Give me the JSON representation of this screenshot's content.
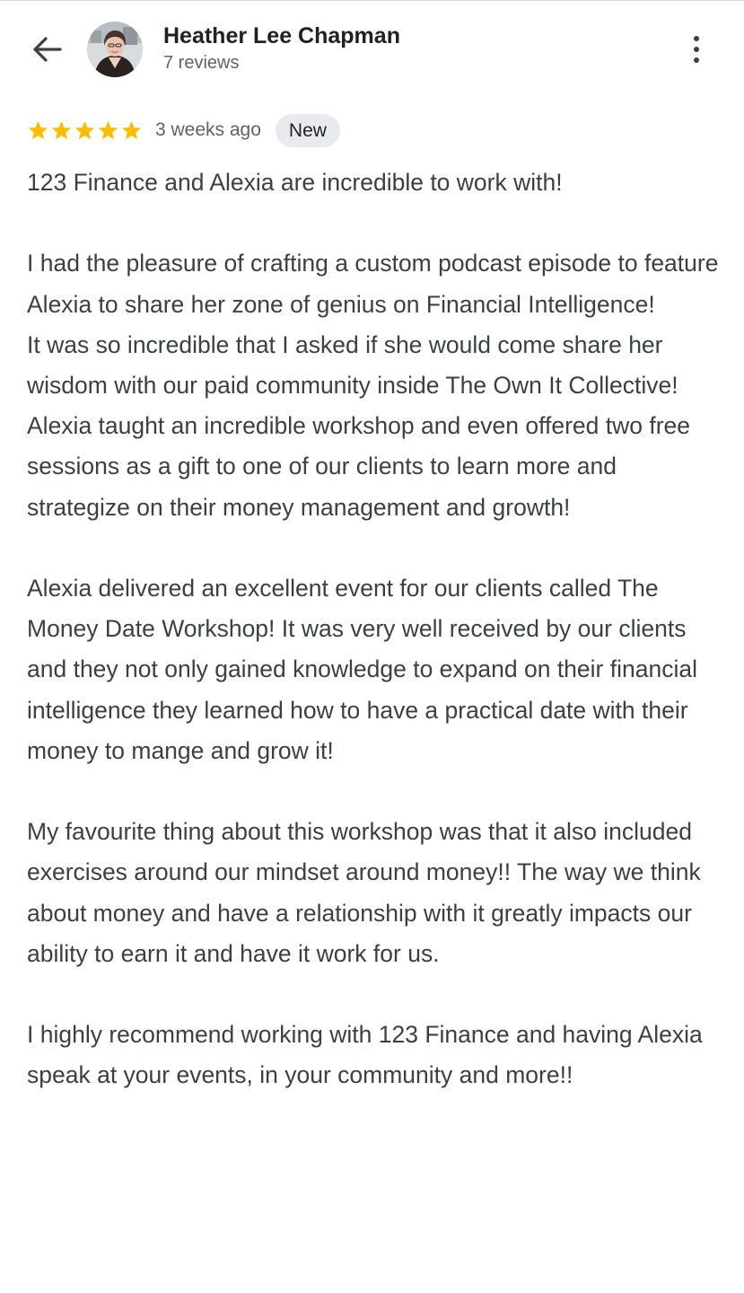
{
  "header": {
    "back_icon": "arrow-left-icon",
    "reviewer_name": "Heather Lee Chapman",
    "reviewer_reviews": "7 reviews",
    "more_icon": "more-vertical-icon"
  },
  "review": {
    "rating": 5,
    "rating_max": 5,
    "star_color": "#fbbc04",
    "time_ago": "3 weeks ago",
    "badge": "New",
    "paragraphs": [
      "123 Finance and Alexia are incredible to work with!",
      "I had the pleasure of crafting a custom podcast episode to feature Alexia to share her zone of genius on Financial Intelligence!\nIt was so incredible that I asked if she would come share her wisdom with our paid community inside The Own It Collective! Alexia taught an incredible workshop and even offered two free sessions as a gift to one of our clients to learn more and strategize on their money management and growth!",
      "Alexia delivered an excellent event for our clients called The Money Date Workshop! It was very well received by our clients and they not only gained knowledge to expand on their financial intelligence they learned how to have a practical date with their money to mange and grow it!",
      "My favourite thing about this workshop was that it also included exercises around our mindset around money!! The way we think about money and have a relationship with it greatly impacts our ability to earn it and have it work for us.",
      "I highly recommend working with 123 Finance and having Alexia speak at your events, in your community and more!!"
    ]
  }
}
